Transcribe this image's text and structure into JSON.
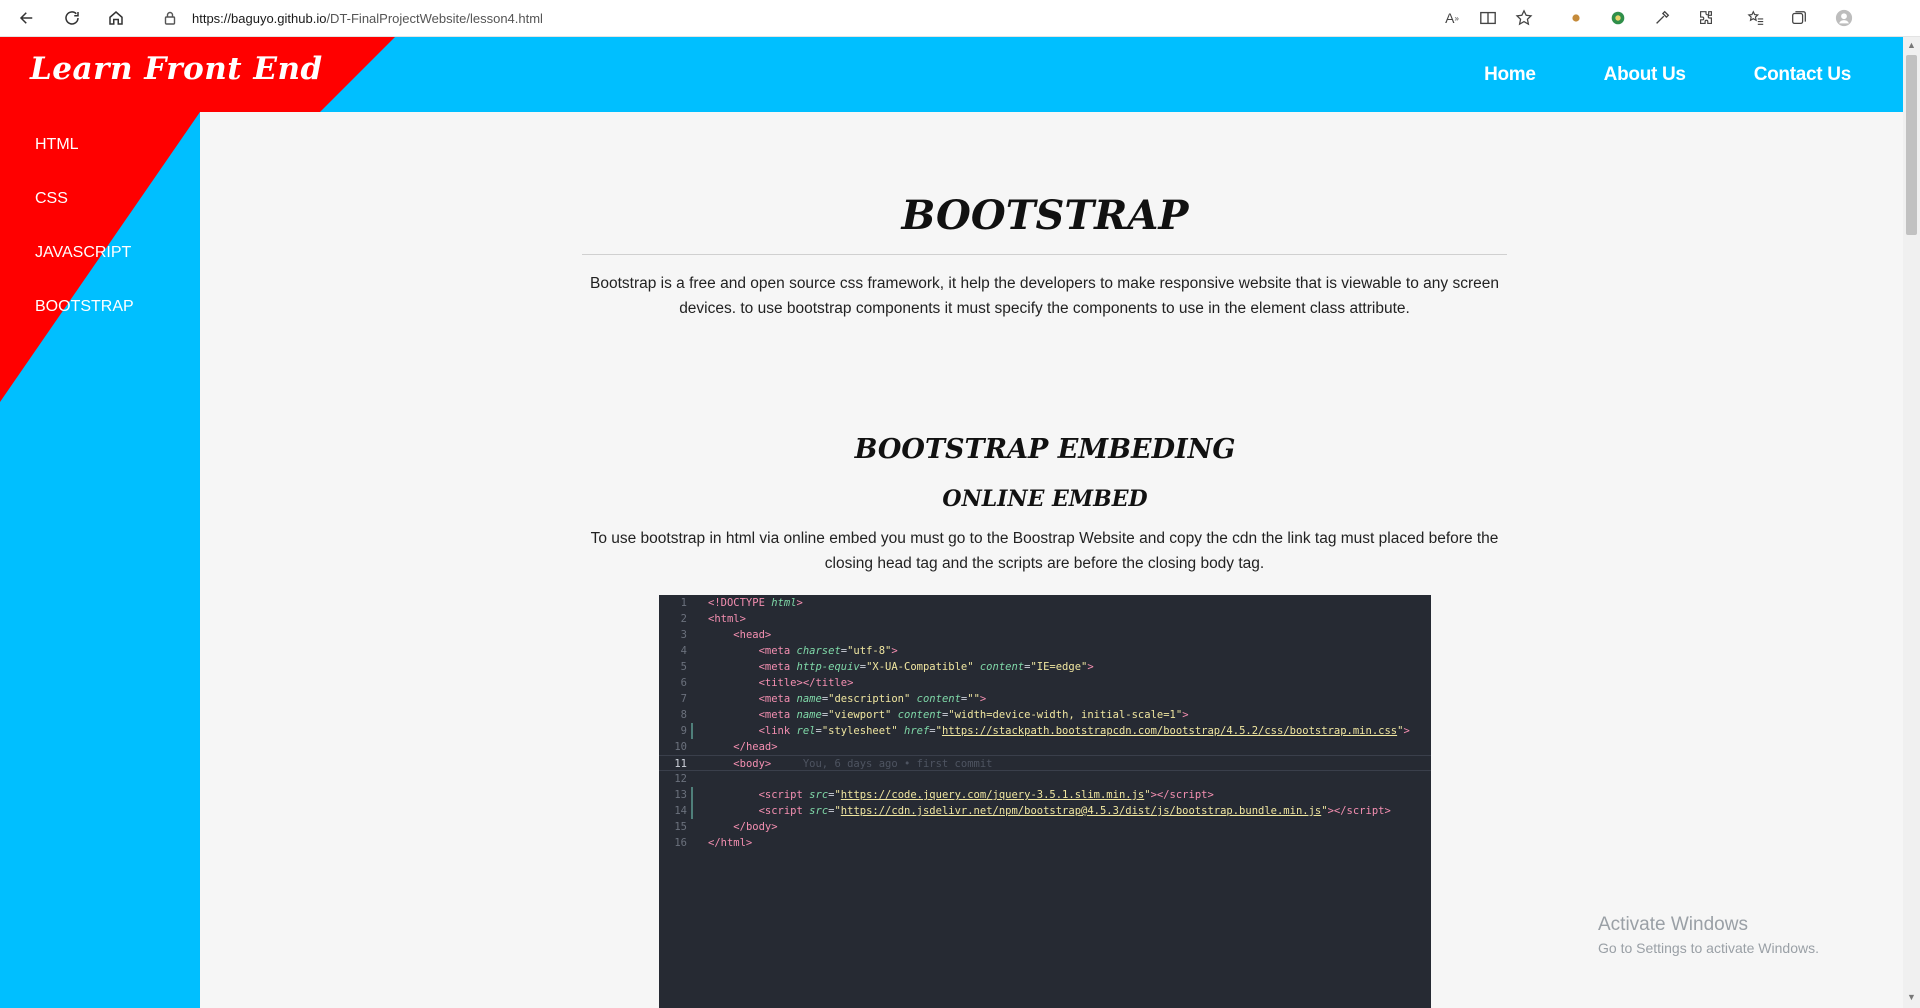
{
  "browser": {
    "url_host": "https://baguyo.github.io",
    "url_path": "/DT-FinalProjectWebsite/lesson4.html"
  },
  "site": {
    "brand": "Learn Front End",
    "nav": [
      "Home",
      "About Us",
      "Contact Us"
    ],
    "sidebar": [
      "HTML",
      "CSS",
      "JAVASCRIPT",
      "BOOTSTRAP"
    ]
  },
  "content": {
    "title": "BOOTSTRAP",
    "intro": "Bootstrap is a free and open source css framework, it help the developers to make responsive website that is viewable to any screen devices. to use bootstrap components it must specify the components to use in the element class attribute.",
    "section_title": "BOOTSTRAP EMBEDING",
    "subsection_title": "ONLINE EMBED",
    "subsection_text": "To use bootstrap in html via online embed you must go to the Boostrap Website and copy the cdn the link tag must placed before the closing head tag and the scripts are before the closing body tag."
  },
  "code_sample": {
    "blame": "You, 6 days ago • first commit",
    "line_numbers": [
      "1",
      "2",
      "3",
      "4",
      "5",
      "6",
      "7",
      "8",
      "9",
      "10",
      "11",
      "12",
      "13",
      "14",
      "15",
      "16"
    ]
  },
  "watermark": {
    "title": "Activate Windows",
    "subtitle": "Go to Settings to activate Windows."
  },
  "colors": {
    "header_blue": "#00bfff",
    "brand_red": "#ff0000",
    "code_bg": "#262a33"
  }
}
